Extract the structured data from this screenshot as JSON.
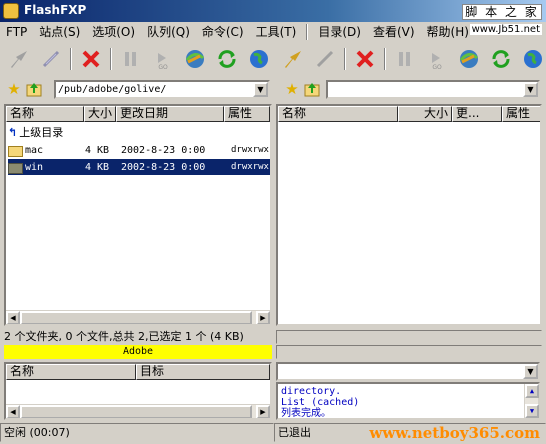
{
  "window": {
    "title": "FlashFXP"
  },
  "watermark": {
    "top": "脚 本 之 家",
    "url": "www.Jb51.net",
    "bottom": "www.netboy365.com"
  },
  "menu": {
    "items": [
      "FTP",
      "站点(S)",
      "选项(O)",
      "队列(Q)",
      "命令(C)",
      "工具(T)",
      "目录(D)",
      "查看(V)",
      "帮助(H)"
    ]
  },
  "icons": {
    "toolbar_left": [
      "connect-icon",
      "disconnect-icon",
      "abort-icon",
      "pause-icon",
      "go-icon",
      "transfer-icon",
      "refresh-icon",
      "globe-icon"
    ],
    "toolbar_right": [
      "connect-icon",
      "disconnect-icon",
      "abort-icon",
      "pause-icon",
      "go-icon",
      "transfer-icon",
      "refresh-icon",
      "globe-icon"
    ]
  },
  "left": {
    "path": "/pub/adobe/golive/",
    "columns": [
      "名称",
      "大小",
      "更改日期",
      "属性"
    ],
    "up_label": "上级目录",
    "files": [
      {
        "name": "mac",
        "size": "4 KB",
        "date": "2002-8-23 0:00",
        "attr": "drwxrwxr"
      },
      {
        "name": "win",
        "size": "4 KB",
        "date": "2002-8-23 0:00",
        "attr": "drwxrwxr"
      }
    ],
    "summary": "2 个文件夹, 0 个文件,总共 2,已选定 1 个 (4 KB)",
    "site": "Adobe",
    "queue_columns": [
      "名称",
      "目标"
    ]
  },
  "right": {
    "path": "",
    "columns": [
      "名称",
      "大小",
      "更...",
      "属性"
    ],
    "log": [
      "directory.",
      "List (cached)",
      "列表完成。"
    ]
  },
  "status": {
    "left": "空闲 (00:07)",
    "right": "已退出"
  }
}
